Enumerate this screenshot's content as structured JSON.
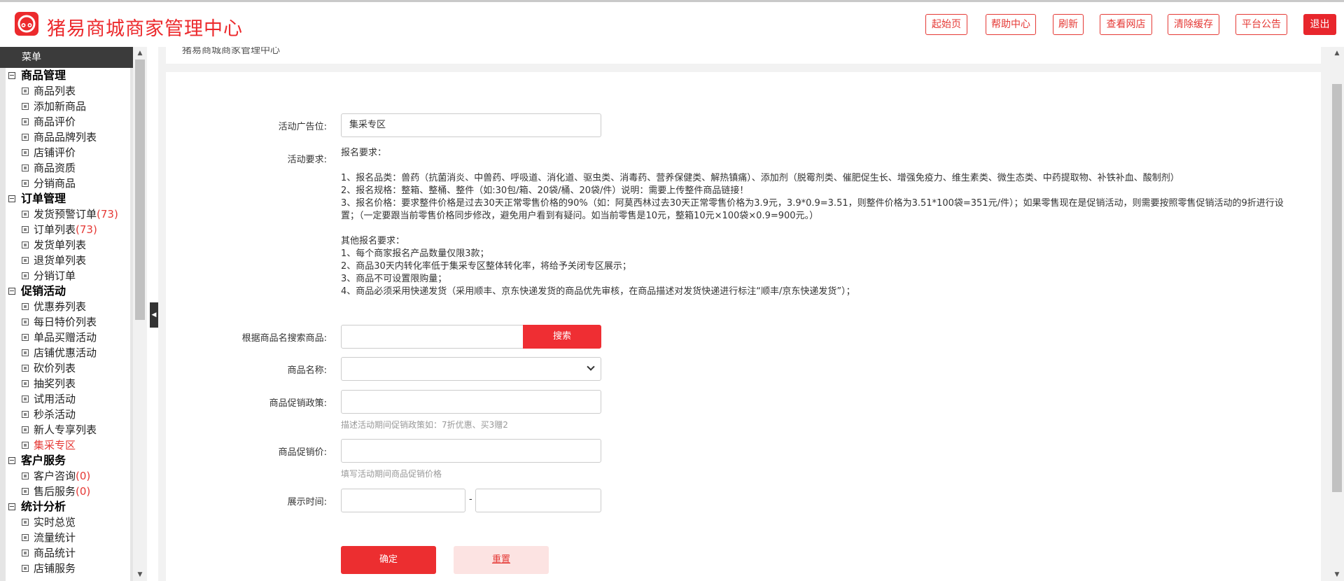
{
  "header": {
    "title": "猪易商城商家管理中心",
    "buttons": [
      "起始页",
      "帮助中心",
      "刷新",
      "查看网店",
      "清除缓存",
      "平台公告",
      "退出"
    ]
  },
  "sidebar": {
    "menu_title": "菜单",
    "groups": [
      {
        "label": "商品管理",
        "items": [
          {
            "label": "商品列表"
          },
          {
            "label": "添加新商品"
          },
          {
            "label": "商品评价"
          },
          {
            "label": "商品品牌列表"
          },
          {
            "label": "店铺评价"
          },
          {
            "label": "商品资质"
          },
          {
            "label": "分销商品"
          }
        ]
      },
      {
        "label": "订单管理",
        "items": [
          {
            "label": "发货预警订单",
            "count": "(73)"
          },
          {
            "label": "订单列表",
            "count": "(73)"
          },
          {
            "label": "发货单列表"
          },
          {
            "label": "退货单列表"
          },
          {
            "label": "分销订单"
          }
        ]
      },
      {
        "label": "促销活动",
        "items": [
          {
            "label": "优惠券列表"
          },
          {
            "label": "每日特价列表"
          },
          {
            "label": "单品买赠活动"
          },
          {
            "label": "店铺优惠活动"
          },
          {
            "label": "砍价列表"
          },
          {
            "label": "抽奖列表"
          },
          {
            "label": "试用活动"
          },
          {
            "label": "秒杀活动"
          },
          {
            "label": "新人专享列表"
          },
          {
            "label": "集采专区",
            "active": true
          }
        ]
      },
      {
        "label": "客户服务",
        "items": [
          {
            "label": "客户咨询",
            "count": "(0)"
          },
          {
            "label": "售后服务",
            "count": "(0)"
          }
        ]
      },
      {
        "label": "统计分析",
        "items": [
          {
            "label": "实时总览"
          },
          {
            "label": "流量统计"
          },
          {
            "label": "商品统计"
          },
          {
            "label": "店铺服务"
          }
        ]
      }
    ]
  },
  "breadcrumb": "猪易商城商家管理中心",
  "form": {
    "ad_slot": {
      "label": "活动广告位:",
      "value": "集采专区"
    },
    "requirements": {
      "label": "活动要求:",
      "lines": [
        "报名要求：",
        "",
        "1、报名品类：兽药（抗菌消炎、中兽药、呼吸道、消化道、驱虫类、消毒药、营养保健类、解热镇痛）、添加剂（脱霉剂类、催肥促生长、增强免疫力、维生素类、微生态类、中药提取物、补铁补血、酸制剂）",
        "2、报名规格：整箱、整桶、整件（如:30包/箱、20袋/桶、20袋/件）说明：需要上传整件商品链接！",
        "3、报名价格：要求整件价格是过去30天正常零售价格的90%（如：阿莫西林过去30天正常零售价格为3.9元，3.9*0.9=3.51，则整件价格为3.51*100袋=351元/件）；如果零售现在是促销活动，则需要按照零售促销活动的9折进行设",
        "置；（一定要跟当前零售价格同步修改，避免用户看到有疑问。如当前零售是10元，整箱10元×100袋×0.9=900元。）",
        "",
        "其他报名要求：",
        "1、每个商家报名产品数量仅限3款；",
        "2、商品30天内转化率低于集采专区整体转化率，将给予关闭专区展示；",
        "3、商品不可设置限购量；",
        "4、商品必须采用快递发货（采用顺丰、京东快递发货的商品优先审核，在商品描述对发货快递进行标注“顺丰/京东快递发货”）；"
      ]
    },
    "search": {
      "label": "根据商品名搜索商品:",
      "value": "",
      "button": "搜索"
    },
    "product_name": {
      "label": "商品名称:",
      "value": ""
    },
    "promo_policy": {
      "label": "商品促销政策:",
      "value": "",
      "hint": "描述活动期间促销政策如：7折优惠、买3赠2"
    },
    "promo_price": {
      "label": "商品促销价:",
      "value": "",
      "hint": "填写活动期间商品促销价格"
    },
    "display_time": {
      "label": "展示时间:",
      "start": "",
      "separator": "-",
      "end": ""
    },
    "confirm_button": "确定",
    "reset_button": "重置"
  },
  "colors": {
    "brand_red": "#ec2a2d",
    "sidebar_header": "#3b3b3b",
    "panel_bg": "#f2f2f2"
  }
}
